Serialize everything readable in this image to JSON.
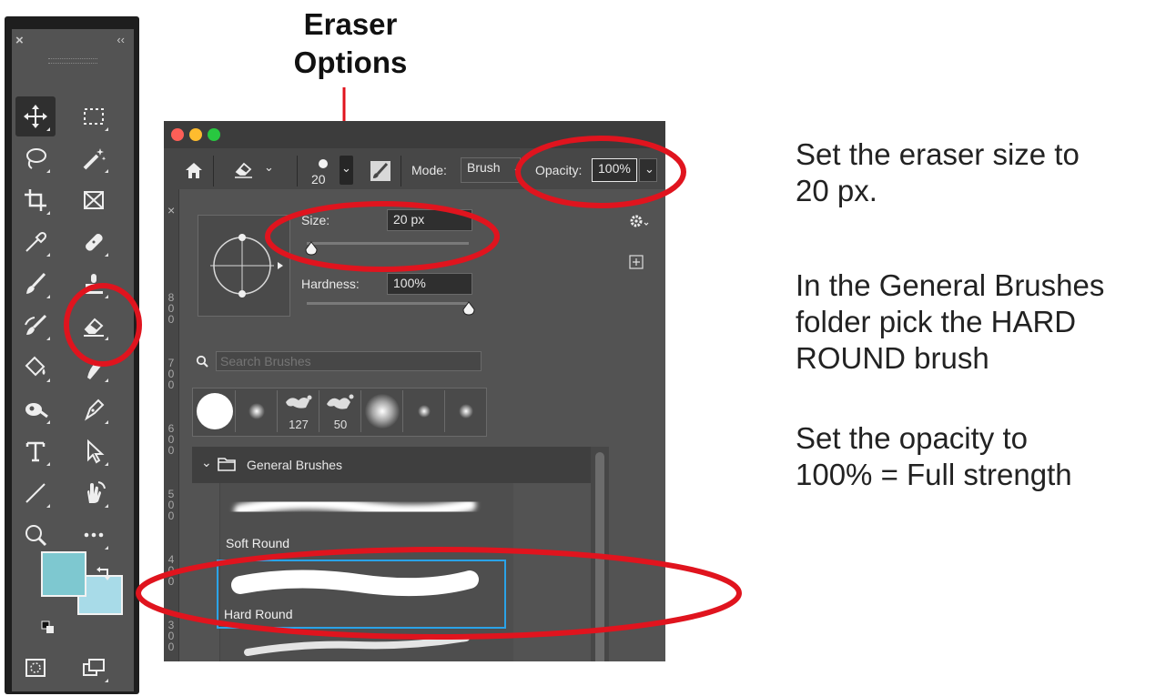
{
  "callout": {
    "title_line1": "Eraser",
    "title_line2": "Options"
  },
  "instructions": {
    "size_line1": "Set the eraser size to",
    "size_line2": "20 px.",
    "brush_line1": "In the General Brushes",
    "brush_line2": "folder pick the HARD",
    "brush_line3": "ROUND brush",
    "opacity_line1": "Set the opacity to",
    "opacity_line2": "100% = Full strength"
  },
  "toolbar": {
    "close_glyph": "×",
    "collapse_glyph": "‹‹",
    "foreground_color": "#7ec8d0",
    "background_color": "#a8dbe8",
    "tools": [
      "move-tool",
      "marquee-tool",
      "lasso-tool",
      "magic-wand-tool",
      "crop-tool",
      "frame-tool",
      "eyedropper-tool",
      "healing-tool",
      "brush-tool",
      "stamp-tool",
      "history-brush-tool",
      "eraser-tool",
      "paint-bucket-tool",
      "smudge-tool",
      "dodge-tool",
      "pen-tool",
      "type-tool",
      "path-select-tool",
      "line-tool",
      "hand-tool",
      "zoom-tool",
      "more-tools",
      "quick-mask",
      "screen-mode"
    ]
  },
  "options_bar": {
    "brush_size_label": "20",
    "mode_label": "Mode:",
    "mode_value": "Brush",
    "opacity_label": "Opacity:",
    "opacity_value": "100%"
  },
  "brush_popup": {
    "size_label": "Size:",
    "size_value": "20 px",
    "size_fraction": 0.03,
    "hardness_label": "Hardness:",
    "hardness_value": "100%",
    "hardness_fraction": 1.0,
    "search_placeholder": "Search Brushes",
    "recent_tips": [
      {
        "label": ""
      },
      {
        "label": ""
      },
      {
        "label": "127"
      },
      {
        "label": "50"
      },
      {
        "label": ""
      },
      {
        "label": ""
      },
      {
        "label": ""
      }
    ],
    "folder_name": "General Brushes",
    "brushes": [
      {
        "name": "Soft Round",
        "selected": false
      },
      {
        "name": "Hard Round",
        "selected": true
      }
    ],
    "side_ruler": [
      "8",
      "0",
      "0",
      "7",
      "0",
      "0",
      "6",
      "0",
      "0",
      "5",
      "0",
      "0",
      "4",
      "0",
      "0",
      "3",
      "0",
      "0"
    ]
  },
  "colors": {
    "annotation_red": "#e0141e",
    "selection_blue": "#2aa3e8"
  }
}
